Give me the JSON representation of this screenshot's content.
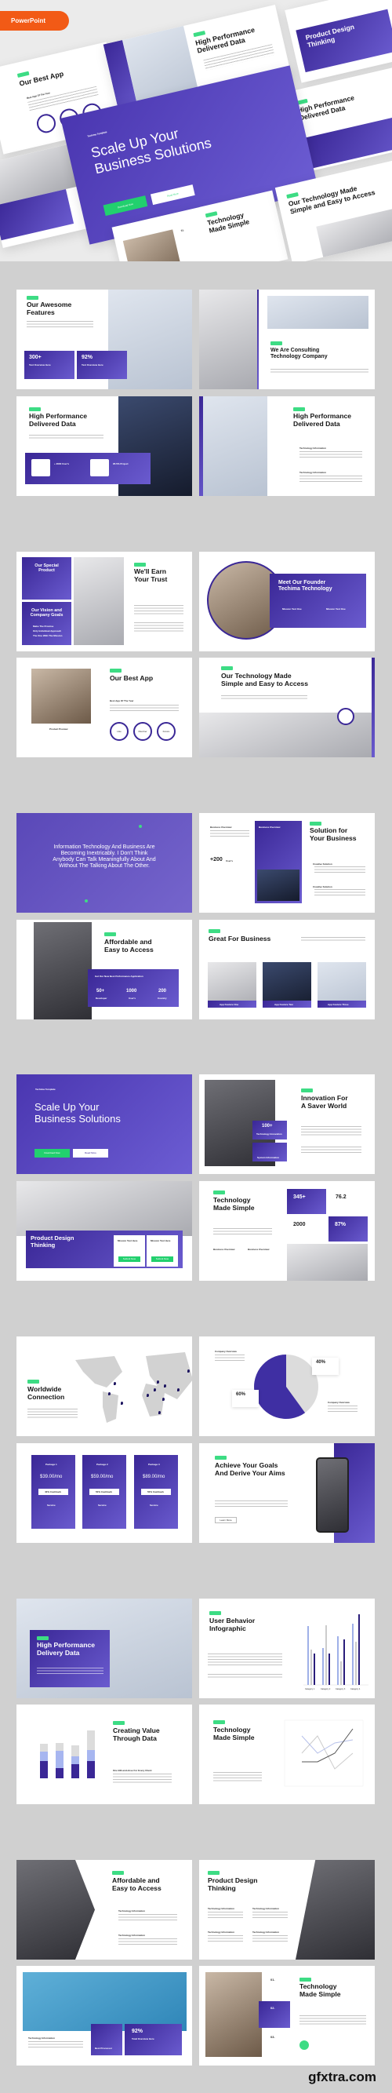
{
  "badge": "PowerPoint",
  "colors": {
    "purple": "#3a2796",
    "green": "#3ddc84",
    "orange": "#f25a16"
  },
  "hero": {
    "best_app": "Our Best App",
    "best_app_sub": "Best App Of The Year",
    "hp": "High Performance\nDelivered Data",
    "pdt": "Product Design\nThinking",
    "main_tag": "Techima Template",
    "main": "Scale Up Your\nBusiness Solutions",
    "main_btn1": "Download Now",
    "main_btn2": "Read More",
    "tms": "Technology\nMade Simple",
    "tms_num": "01.",
    "otm": "Our Technology Made\nSimple and Easy to Access",
    "hp2": "High Performance\nDelivered Data"
  },
  "g1": {
    "s1": {
      "title": "Our Awesome\nFeatures",
      "stat1": "300+",
      "stat2": "92%",
      "stat_label": "Text Overview Here"
    },
    "s2": {
      "title": "We Are Consulting\nTechnology Company"
    },
    "s3": {
      "title": "High Performance\nDelivered Data",
      "f1": "+ 2000 User's",
      "f2": "95.5% Project"
    },
    "s4": {
      "title": "High Performance\nDelivered Data",
      "b1": "Technology Information",
      "b2": "Technology Information"
    }
  },
  "g2": {
    "s1": {
      "box1": "Our Special\nProduct",
      "box2": "Our Vision and\nCompany Goals",
      "list": [
        "Make The Promise",
        "Only Individual Approach",
        "The One With The Mission"
      ],
      "title": "We'll Earn\nYour Trust"
    },
    "s2": {
      "title": "Meet Our Founder\nTechima Technology",
      "m1": "Mission Text One",
      "m2": "Mission Text One"
    },
    "s3": {
      "caption": "Product Preview",
      "title": "Our Best App",
      "sub": "Best App Of The Year",
      "c1": "Like",
      "c2": "Member",
      "c3": "Future"
    },
    "s4": {
      "title": "Our Technology Made\nSimple and Easy to Access"
    }
  },
  "g3": {
    "s1": {
      "quote": "Information Technology And Business Are\nBecoming Inextricably. I Don't Think\nAnybody Can Talk Meaningfully About And\nWithout The Talking About The Other."
    },
    "s2": {
      "title": "Solution for\nYour Business",
      "ov1": "Business Overview",
      "ov2": "Business Overview",
      "stat": "+200",
      "stat_unit": "User's",
      "b1": "Creative Solution",
      "b2": "Creative Solution"
    },
    "s3": {
      "title": "Affordable and\nEasy to Access",
      "box_title": "Get Our New Best Performance Application",
      "n1": "50+",
      "l1": "Developer",
      "n2": "1000",
      "l2": "User's",
      "n3": "200",
      "l3": "Country"
    },
    "s4": {
      "title": "Great For Business",
      "f1": "App Feature One",
      "f2": "App Feature Two",
      "f3": "App Feature Three"
    }
  },
  "g4": {
    "s1": {
      "tag": "Techima Template",
      "title": "Scale Up Your\nBusiness Solutions",
      "btn1": "Download Now",
      "btn2": "Read More"
    },
    "s2": {
      "title": "Innovation For\nA Saver World",
      "stat": "100+",
      "stat_label": "Technology Innovation",
      "box2": "System Information"
    },
    "s3": {
      "title": "Product Design\nThinking",
      "m1": "Mission Text Here",
      "m2": "Mission Text Here",
      "btn": "Submit Now"
    },
    "s4": {
      "title": "Technology\nMade Simple",
      "n1": "345+",
      "n2": "76.2",
      "n3": "2000",
      "n4": "87%",
      "ov1": "Business Overview",
      "ov2": "Business Overview"
    }
  },
  "g5": {
    "s1": {
      "title": "Worldwide\nConnection"
    },
    "s2": {
      "ov1": "Company Overview",
      "ov2": "Company Overview",
      "p1": "40%",
      "p2": "60%"
    },
    "s3": {
      "packages": [
        {
          "name": "Package 1",
          "price": "$39.00/mo",
          "disc": "40% Cashback"
        },
        {
          "name": "Package 2",
          "price": "$59.00/mo",
          "disc": "50% Cashback"
        },
        {
          "name": "Package 3",
          "price": "$89.00/mo",
          "disc": "50% Cashback"
        }
      ],
      "service": "Service"
    },
    "s4": {
      "title": "Achieve Your Goals\nAnd Derive Your Aims",
      "btn": "Learn More"
    }
  },
  "g6": {
    "s1": {
      "title": "High Performance\nDelivery Data"
    },
    "s2": {
      "title": "User Behavior\nInfographic",
      "cats": [
        "Category 1",
        "Category 2",
        "Category 3",
        "Category 4"
      ]
    },
    "s3": {
      "title": "Creating Value\nThrough Data",
      "sub": "One Bill-and-dose For Every Client"
    },
    "s4": {
      "title": "Technology\nMade Simple"
    }
  },
  "g7": {
    "s1": {
      "title": "Affordable and\nEasy to Access",
      "b1": "Technology Information",
      "b2": "Technology Information"
    },
    "s2": {
      "title": "Product Design\nThinking",
      "t": "Technology Information"
    },
    "s3": {
      "info": "Technology Information",
      "box1": "Best Processor",
      "stat": "92%",
      "stat_label": "Total Overview Here"
    },
    "s4": {
      "title": "Technology\nMade Simple",
      "n1": "01.",
      "n2": "02.",
      "n3": "03."
    }
  },
  "watermark": "gfxtra.com"
}
